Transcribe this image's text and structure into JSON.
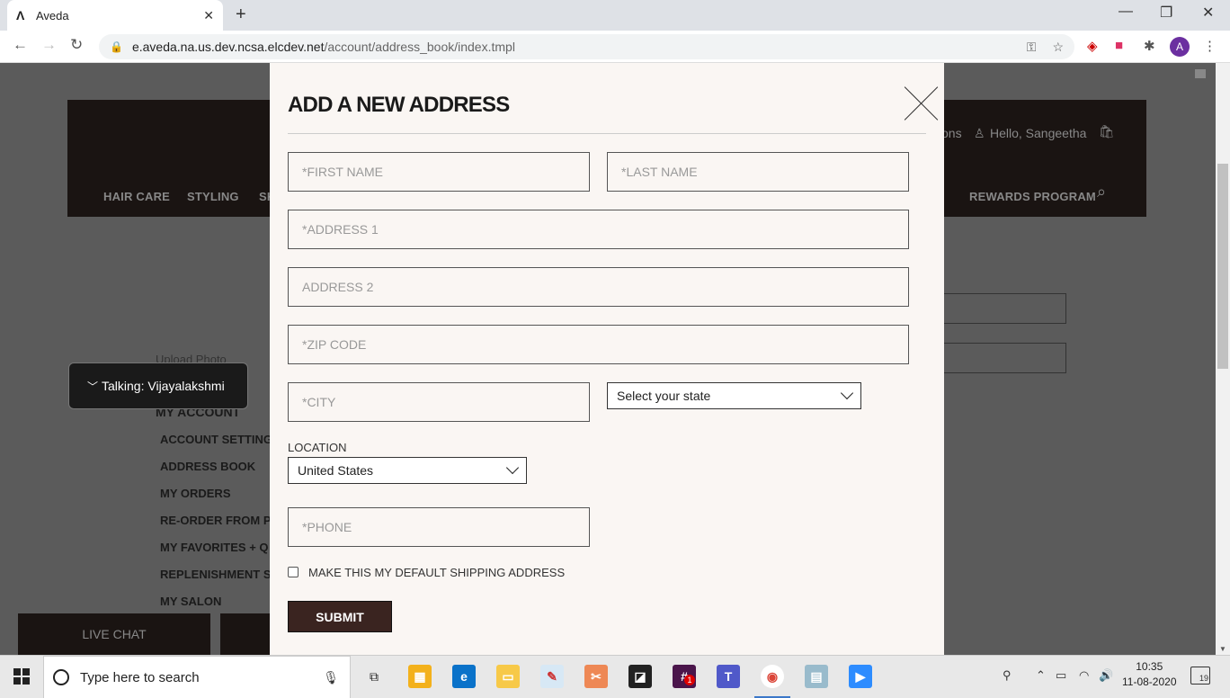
{
  "browser": {
    "tab_title": "Aveda",
    "tab_favicon": "Λ",
    "url_host": "e.aveda.na.us.dev.ncsa.elcdev.net",
    "url_path": "/account/address_book/index.tmpl",
    "avatar_initial": "A"
  },
  "site": {
    "nav": [
      "HAIR CARE",
      "STYLING",
      "SK",
      "REWARDS PROGRAM"
    ],
    "partial_link": "ons",
    "greeting": "Hello, Sangeetha",
    "upload_photo": "Upload Photo",
    "my_account": "MY ACCOUNT",
    "account_menu": [
      "ACCOUNT SETTINGS",
      "ADDRESS BOOK",
      "MY ORDERS",
      "RE-ORDER FROM PA",
      "MY FAVORITES + Q",
      "REPLENISHMENT S",
      "MY SALON"
    ],
    "live_chat": "LIVE CHAT",
    "talking": "Talking: Vijayalakshmi"
  },
  "modal": {
    "title": "ADD A NEW ADDRESS",
    "first_name_placeholder": "*FIRST NAME",
    "last_name_placeholder": "*LAST NAME",
    "address1_placeholder": "*ADDRESS 1",
    "address2_placeholder": "ADDRESS 2",
    "zip_placeholder": "*ZIP CODE",
    "city_placeholder": "*CITY",
    "state_value": "Select your state",
    "location_label": "LOCATION",
    "location_value": "United States",
    "phone_placeholder": "*PHONE",
    "default_shipping_label": "MAKE THIS MY DEFAULT SHIPPING ADDRESS",
    "default_shipping_checked": false,
    "submit_label": "SUBMIT"
  },
  "taskbar": {
    "search_placeholder": "Type here to search",
    "time": "10:35",
    "date": "11-08-2020",
    "notifications_count": "19",
    "slack_badge": "1"
  },
  "colors": {
    "modal_bg": "#faf6f3",
    "submit_bg": "#3a2420",
    "header_bg": "#1a1412"
  }
}
